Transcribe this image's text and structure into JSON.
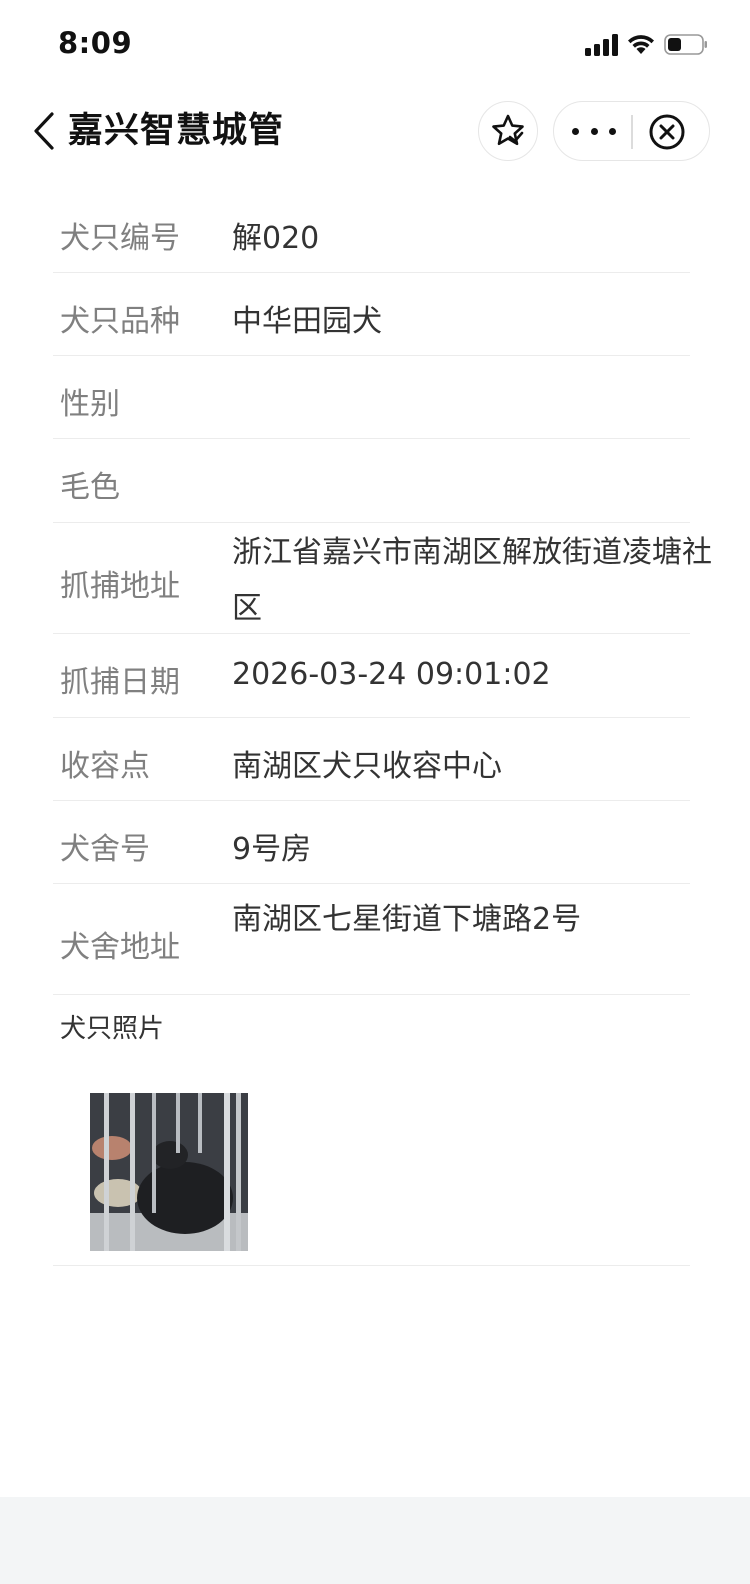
{
  "status_bar": {
    "time": "8:09"
  },
  "nav": {
    "title": "嘉兴智慧城管"
  },
  "fields": [
    {
      "label": "犬只编号",
      "value": "解020"
    },
    {
      "label": "犬只品种",
      "value": "中华田园犬"
    },
    {
      "label": "性别",
      "value": ""
    },
    {
      "label": "毛色",
      "value": ""
    },
    {
      "label": "抓捕地址",
      "value": "浙江省嘉兴市南湖区解放街道凌塘社区"
    },
    {
      "label": "抓捕日期",
      "value": "2026-03-24 09:01:02"
    },
    {
      "label": "收容点",
      "value": "南湖区犬只收容中心"
    },
    {
      "label": "犬舍号",
      "value": "9号房"
    },
    {
      "label": "犬舍地址",
      "value": "南湖区七星街道下塘路2号"
    }
  ],
  "photo_section": {
    "label": "犬只照片"
  },
  "colors": {
    "label_text": "#808080",
    "value_text": "#333333",
    "divider": "#ececec",
    "footer_bg": "#f3f5f6"
  }
}
